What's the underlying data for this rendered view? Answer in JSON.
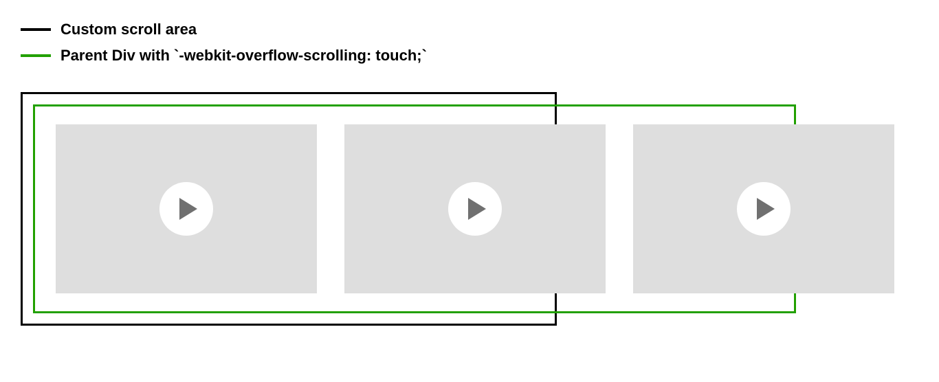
{
  "legend": {
    "items": [
      {
        "label": "Custom scroll area",
        "color": "#000000"
      },
      {
        "label": "Parent Div with `-webkit-overflow-scrolling: touch;`",
        "color": "#22a000"
      }
    ]
  },
  "diagram": {
    "video_cards_count": 3
  }
}
